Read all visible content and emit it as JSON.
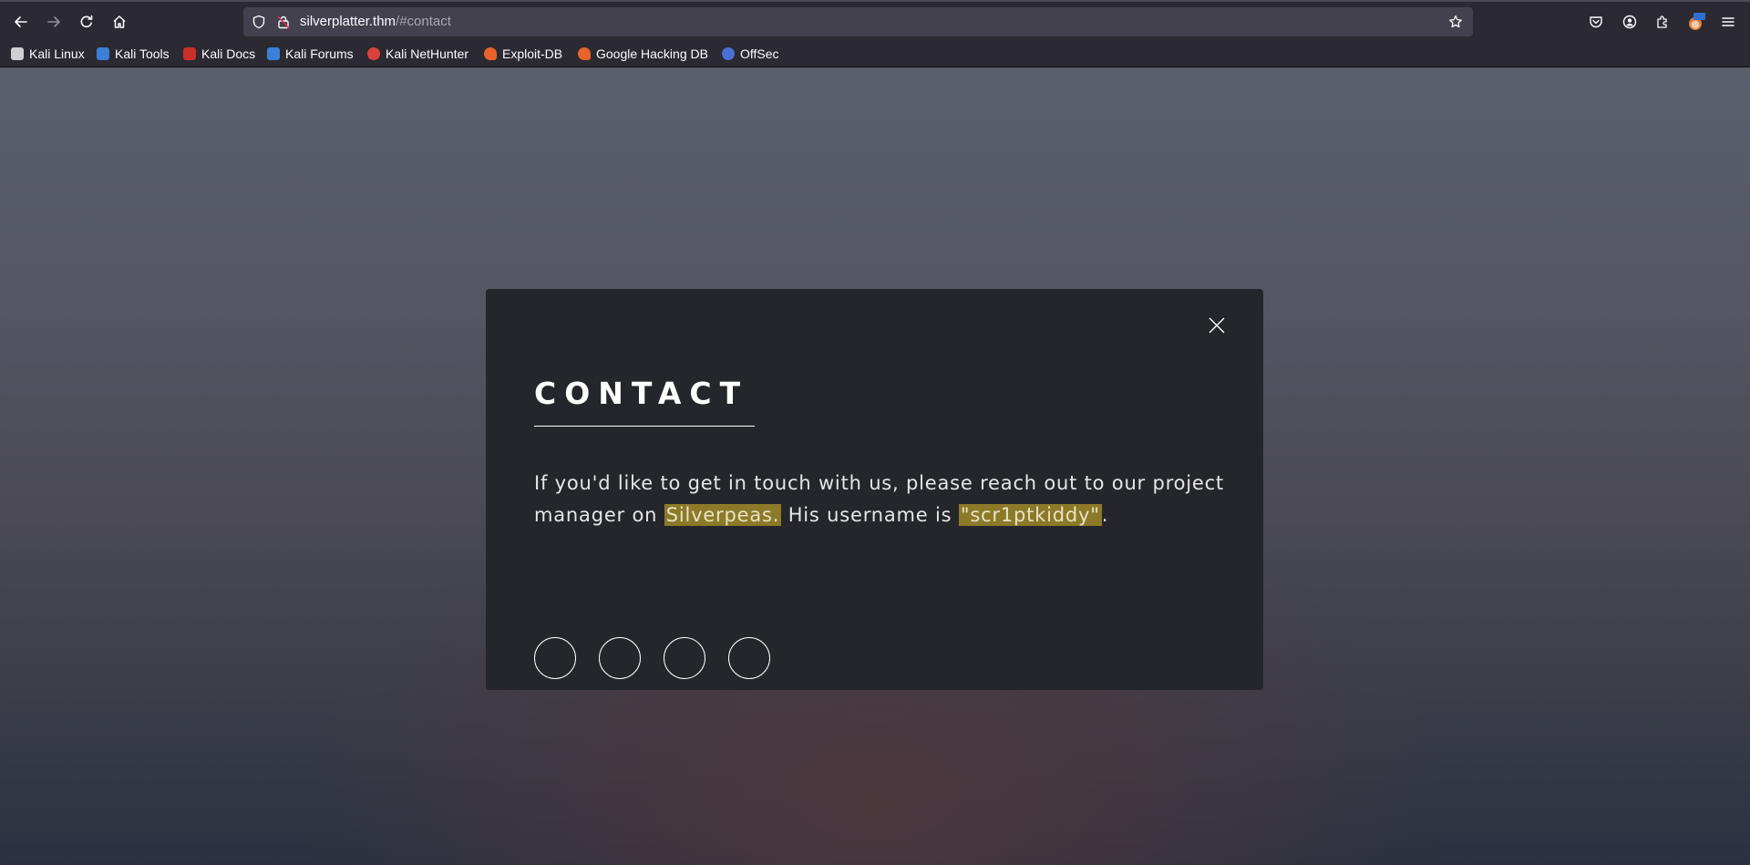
{
  "browser": {
    "url_host": "silverplatter.thm",
    "url_path": "/#contact",
    "bookmarks": [
      {
        "label": "Kali Linux",
        "icon": "kali-linux-icon",
        "color": "#cfcfd4"
      },
      {
        "label": "Kali Tools",
        "icon": "kali-tools-icon",
        "color": "#3b7fd6"
      },
      {
        "label": "Kali Docs",
        "icon": "kali-docs-icon",
        "color": "#c9302c"
      },
      {
        "label": "Kali Forums",
        "icon": "kali-forums-icon",
        "color": "#3b7fd6"
      },
      {
        "label": "Kali NetHunter",
        "icon": "kali-nethunter-icon",
        "color": "#d9433b"
      },
      {
        "label": "Exploit-DB",
        "icon": "exploit-db-icon",
        "color": "#e8632b"
      },
      {
        "label": "Google Hacking DB",
        "icon": "google-hacking-db-icon",
        "color": "#e8632b"
      },
      {
        "label": "OffSec",
        "icon": "offsec-icon",
        "color": "#4a6fd6"
      }
    ]
  },
  "modal": {
    "title": "CONTACT",
    "text_before": "If you'd like to get in touch with us, please reach out to our project manager on ",
    "highlight_platform": "Silverpeas.",
    "text_middle": " His username is ",
    "highlight_username": "\"scr1ptkiddy\"",
    "text_after": ".",
    "highlight_color": "#8c7a29",
    "social_icons": [
      "social-icon-1",
      "social-icon-2",
      "social-icon-3",
      "social-icon-4"
    ]
  }
}
